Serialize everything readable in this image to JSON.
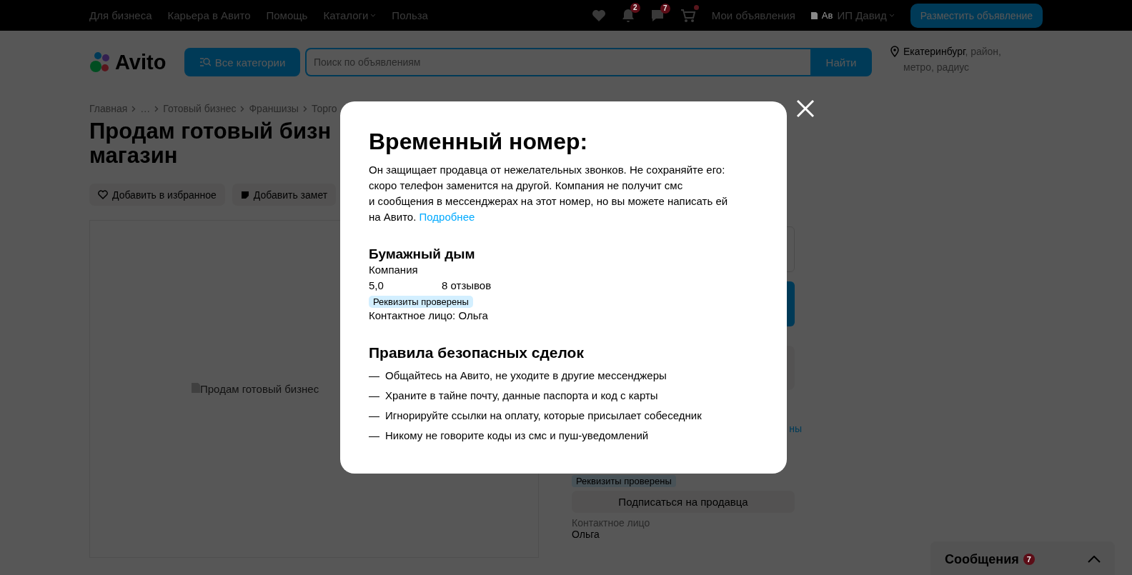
{
  "top_bar": {
    "links": [
      {
        "label": "Для бизнеса",
        "kind": "link"
      },
      {
        "label": "Карьера в Авито",
        "kind": "link"
      },
      {
        "label": "Помощь",
        "kind": "link"
      },
      {
        "label": "Каталоги",
        "kind": "dropdown"
      },
      {
        "label": "Польза",
        "kind": "link"
      }
    ],
    "notifications_badge": "2",
    "messages_badge": "7",
    "cart_has_items": true,
    "my_ads": "Мои объявления",
    "avatar_alt": "Ав",
    "account": "ИП Давид",
    "post_button": "Разместить объявление"
  },
  "header": {
    "logo": "Avito",
    "categories_button": "Все категории",
    "search": {
      "placeholder": "Поиск по объявлениям"
    },
    "search_button": "Найти",
    "location": {
      "city": "Екатеринбург",
      "rest": ", район, метро, радиус"
    }
  },
  "breadcrumbs": [
    "Главная",
    "…",
    "Готовый бизнес",
    "Франшизы",
    "Торго"
  ],
  "listing": {
    "title_lines": [
      "Продам готовый бизн",
      "магазин"
    ],
    "actions": [
      {
        "label": "Добавить в избранное",
        "kind": "favorite"
      },
      {
        "label": "Добавить замет",
        "kind": "note"
      }
    ],
    "image": {
      "alt": "Продам готовый бизнес"
    }
  },
  "seller_panel": {
    "link_fragment": "ны",
    "verified_badge": "Реквизиты проверены",
    "subscribe_button": "Подписаться на продавца",
    "contact_label": "Контактное лицо",
    "contact_name": "Ольга"
  },
  "messenger": {
    "title": "Сообщения",
    "badge": "7",
    "expanded": false
  },
  "modal": {
    "title": "Временный номер:",
    "text_lines": [
      "Он защищает продавца от нежелательных звонков. Не сохраняйте его:",
      "скоро телефон заменится на другой. Компания не получит смс",
      "и сообщения в мессенджерах на этот номер, но вы можете написать ей",
      "на Авито."
    ],
    "more_link": "Подробнее",
    "seller": {
      "name": "Бумажный дым",
      "type": "Компания",
      "rating": "5,0",
      "reviews": "8 отзывов",
      "badge": "Реквизиты проверены",
      "contact": "Контактное лицо: Ольга"
    },
    "rules_title": "Правила безопасных сделок",
    "rules": [
      "Общайтесь на Авито, не уходите в другие мессенджеры",
      "Храните в тайне почту, данные паспорта и код с карты",
      "Игнорируйте ссылки на оплату, которые присылает собеседник",
      "Никому не говорите коды из смс и пуш-уведомлений"
    ],
    "bullet": "—"
  }
}
